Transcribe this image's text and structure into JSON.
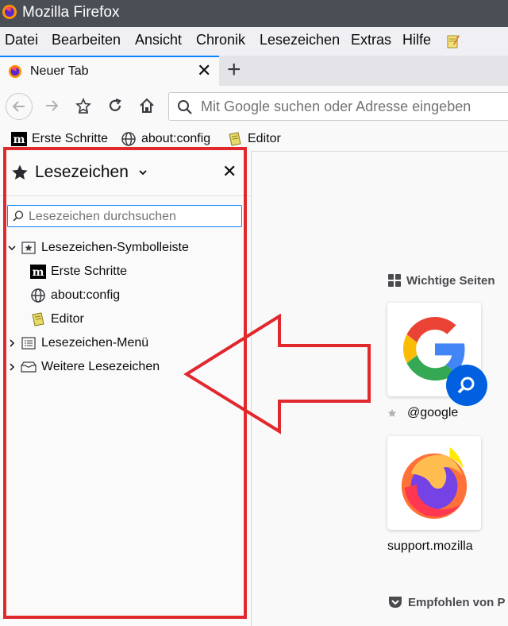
{
  "window": {
    "title": "Mozilla Firefox"
  },
  "menu": {
    "items": [
      {
        "label": "Datei"
      },
      {
        "label": "Bearbeiten"
      },
      {
        "label": "Ansicht"
      },
      {
        "label": "Chronik"
      },
      {
        "label": "Lesezeichen"
      },
      {
        "label": "Extras"
      },
      {
        "label": "Hilfe"
      }
    ]
  },
  "tab": {
    "label": "Neuer Tab",
    "icon": "firefox-icon"
  },
  "urlbar": {
    "placeholder": "Mit Google suchen oder Adresse eingeben"
  },
  "bookmarks_toolbar": {
    "items": [
      {
        "label": "Erste Schritte",
        "icon": "mozilla-m-icon"
      },
      {
        "label": "about:config",
        "icon": "globe-icon"
      },
      {
        "label": "Editor",
        "icon": "notepad-icon"
      }
    ]
  },
  "sidebar": {
    "title": "Lesezeichen",
    "search_placeholder": "Lesezeichen durchsuchen",
    "tree": {
      "toolbar_folder": "Lesezeichen-Symbolleiste",
      "children": [
        {
          "label": "Erste Schritte",
          "icon": "mozilla-m-icon"
        },
        {
          "label": "about:config",
          "icon": "globe-icon"
        },
        {
          "label": "Editor",
          "icon": "notepad-icon"
        }
      ],
      "menu_folder": "Lesezeichen-Menü",
      "other_folder": "Weitere Lesezeichen"
    }
  },
  "newtab": {
    "top_sites_title": "Wichtige Seiten",
    "tiles": [
      {
        "label": "@google",
        "icon": "google-icon"
      },
      {
        "label": "support.mozilla",
        "icon": "firefox-icon"
      }
    ],
    "recommended_title": "Empfohlen von P"
  },
  "colors": {
    "highlight": "#e0282d",
    "titlebar": "#4a4f55",
    "accent": "#0a84ff"
  }
}
